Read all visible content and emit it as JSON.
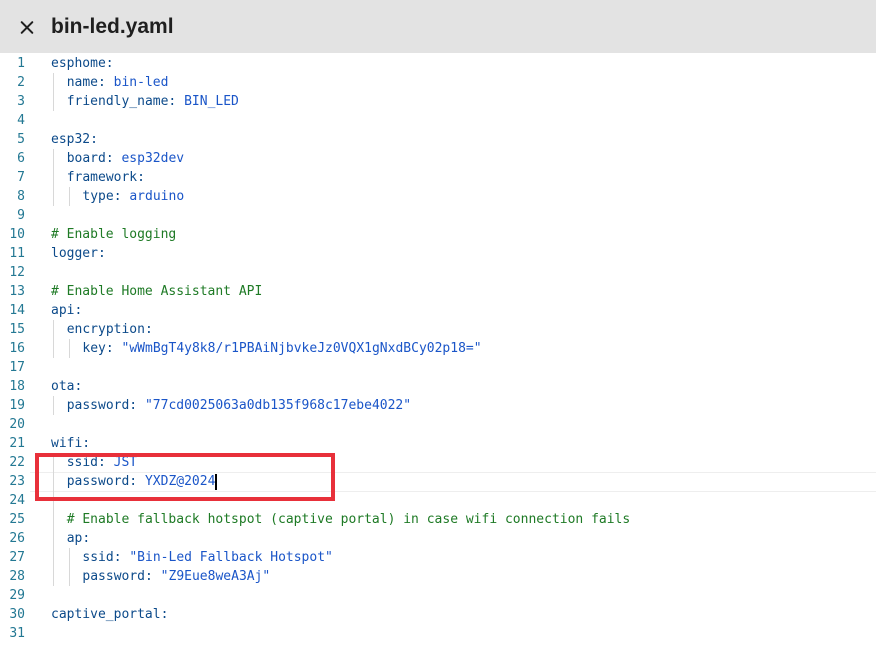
{
  "header": {
    "title": "bin-led.yaml",
    "close_icon": "close-icon"
  },
  "lines": [
    {
      "n": "1",
      "indent": 0,
      "key": "esphome:",
      "value": "",
      "comment": ""
    },
    {
      "n": "2",
      "indent": 1,
      "key": "name: ",
      "value": "bin-led",
      "comment": ""
    },
    {
      "n": "3",
      "indent": 1,
      "key": "friendly_name: ",
      "value": "BIN_LED",
      "comment": ""
    },
    {
      "n": "4",
      "indent": 0,
      "key": "",
      "value": "",
      "comment": ""
    },
    {
      "n": "5",
      "indent": 0,
      "key": "esp32:",
      "value": "",
      "comment": ""
    },
    {
      "n": "6",
      "indent": 1,
      "key": "board: ",
      "value": "esp32dev",
      "comment": ""
    },
    {
      "n": "7",
      "indent": 1,
      "key": "framework:",
      "value": "",
      "comment": ""
    },
    {
      "n": "8",
      "indent": 2,
      "key": "type: ",
      "value": "arduino",
      "comment": ""
    },
    {
      "n": "9",
      "indent": 0,
      "key": "",
      "value": "",
      "comment": ""
    },
    {
      "n": "10",
      "indent": 0,
      "key": "",
      "value": "",
      "comment": "# Enable logging"
    },
    {
      "n": "11",
      "indent": 0,
      "key": "logger:",
      "value": "",
      "comment": ""
    },
    {
      "n": "12",
      "indent": 0,
      "key": "",
      "value": "",
      "comment": ""
    },
    {
      "n": "13",
      "indent": 0,
      "key": "",
      "value": "",
      "comment": "# Enable Home Assistant API"
    },
    {
      "n": "14",
      "indent": 0,
      "key": "api:",
      "value": "",
      "comment": ""
    },
    {
      "n": "15",
      "indent": 1,
      "key": "encryption:",
      "value": "",
      "comment": ""
    },
    {
      "n": "16",
      "indent": 2,
      "key": "key: ",
      "value": "\"wWmBgT4y8k8/r1PBAiNjbvkeJz0VQX1gNxdBCy02p18=\"",
      "comment": ""
    },
    {
      "n": "17",
      "indent": 0,
      "key": "",
      "value": "",
      "comment": ""
    },
    {
      "n": "18",
      "indent": 0,
      "key": "ota:",
      "value": "",
      "comment": ""
    },
    {
      "n": "19",
      "indent": 1,
      "key": "password: ",
      "value": "\"77cd0025063a0db135f968c17ebe4022\"",
      "comment": ""
    },
    {
      "n": "20",
      "indent": 0,
      "key": "",
      "value": "",
      "comment": ""
    },
    {
      "n": "21",
      "indent": 0,
      "key": "wifi:",
      "value": "",
      "comment": ""
    },
    {
      "n": "22",
      "indent": 1,
      "key": "ssid: ",
      "value": "JST",
      "comment": ""
    },
    {
      "n": "23",
      "indent": 1,
      "key": "password: ",
      "value": "YXDZ@2024",
      "comment": "",
      "current": true
    },
    {
      "n": "24",
      "indent": 1,
      "key": "",
      "value": "",
      "comment": "",
      "blank_guide": true
    },
    {
      "n": "25",
      "indent": 1,
      "key": "",
      "value": "",
      "comment": "# Enable fallback hotspot (captive portal) in case wifi connection fails"
    },
    {
      "n": "26",
      "indent": 1,
      "key": "ap:",
      "value": "",
      "comment": ""
    },
    {
      "n": "27",
      "indent": 2,
      "key": "ssid: ",
      "value": "\"Bin-Led Fallback Hotspot\"",
      "comment": ""
    },
    {
      "n": "28",
      "indent": 2,
      "key": "password: ",
      "value": "\"Z9Eue8weA3Aj\"",
      "comment": ""
    },
    {
      "n": "29",
      "indent": 0,
      "key": "",
      "value": "",
      "comment": ""
    },
    {
      "n": "30",
      "indent": 0,
      "key": "captive_portal:",
      "value": "",
      "comment": ""
    },
    {
      "n": "31",
      "indent": 0,
      "key": "",
      "value": "",
      "comment": ""
    }
  ],
  "highlight": {
    "color": "#e8303a",
    "marks_lines": [
      "22",
      "23"
    ]
  }
}
